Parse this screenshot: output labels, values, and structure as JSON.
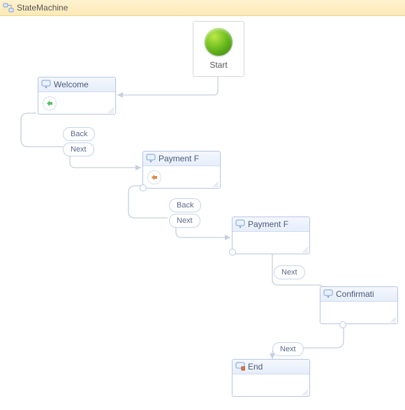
{
  "header": {
    "title": "StateMachine"
  },
  "start": {
    "label": "Start"
  },
  "states": {
    "welcome": {
      "title": "Welcome"
    },
    "payment1": {
      "title": "Payment F"
    },
    "payment2": {
      "title": "Payment F"
    },
    "confirm": {
      "title": "Confirmati"
    },
    "end": {
      "title": "End"
    }
  },
  "transitions": {
    "welcome_back": "Back",
    "welcome_next": "Next",
    "payment1_back": "Back",
    "payment1_next": "Next",
    "payment2_next": "Next",
    "confirm_next": "Next"
  }
}
